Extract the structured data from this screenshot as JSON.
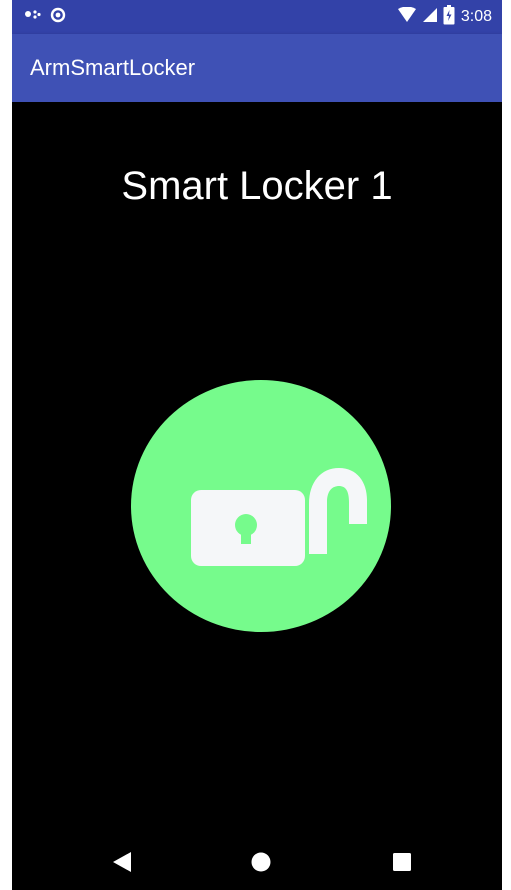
{
  "status_bar": {
    "time": "3:08",
    "icons": [
      "notification-dots-icon",
      "sync-circle-icon",
      "wifi-icon",
      "signal-icon",
      "battery-icon"
    ]
  },
  "app_bar": {
    "title": "ArmSmartLocker"
  },
  "main": {
    "locker_name": "Smart Locker 1",
    "lock_state_icon": "unlocked-padlock-icon",
    "lock_button_color": "#76fb8c",
    "padlock_color": "#f5f7f9"
  },
  "nav_bar": {
    "buttons": [
      "back-icon",
      "home-icon",
      "recents-icon"
    ]
  },
  "colors": {
    "status_bar": "#3342a8",
    "app_bar": "#3f51b5",
    "background": "#000000"
  }
}
